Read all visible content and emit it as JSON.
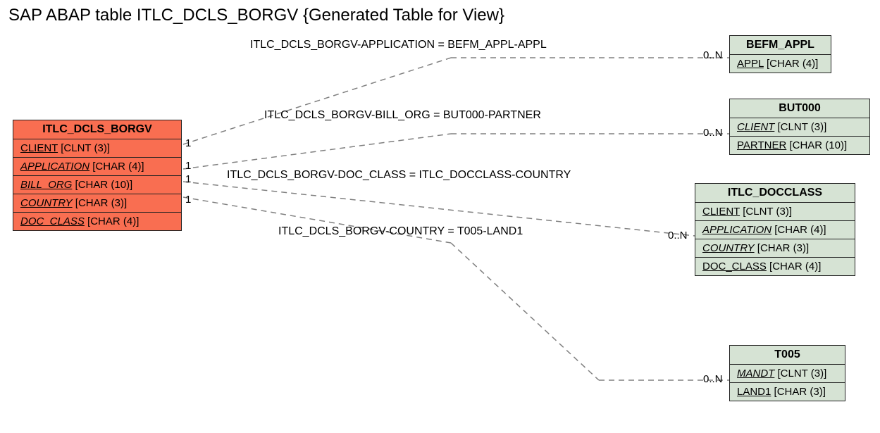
{
  "title": "SAP ABAP table ITLC_DCLS_BORGV {Generated Table for View}",
  "entities": {
    "main": {
      "name": "ITLC_DCLS_BORGV",
      "fields": [
        {
          "name": "CLIENT",
          "type": "[CLNT (3)]",
          "underline": true,
          "italic": false
        },
        {
          "name": "APPLICATION",
          "type": "[CHAR (4)]",
          "underline": true,
          "italic": true
        },
        {
          "name": "BILL_ORG",
          "type": "[CHAR (10)]",
          "underline": true,
          "italic": true
        },
        {
          "name": "COUNTRY",
          "type": "[CHAR (3)]",
          "underline": true,
          "italic": true
        },
        {
          "name": "DOC_CLASS",
          "type": "[CHAR (4)]",
          "underline": true,
          "italic": true
        }
      ]
    },
    "befm_appl": {
      "name": "BEFM_APPL",
      "fields": [
        {
          "name": "APPL",
          "type": "[CHAR (4)]",
          "underline": true,
          "italic": false
        }
      ]
    },
    "but000": {
      "name": "BUT000",
      "fields": [
        {
          "name": "CLIENT",
          "type": "[CLNT (3)]",
          "underline": true,
          "italic": true
        },
        {
          "name": "PARTNER",
          "type": "[CHAR (10)]",
          "underline": true,
          "italic": false
        }
      ]
    },
    "itlc_docclass": {
      "name": "ITLC_DOCCLASS",
      "fields": [
        {
          "name": "CLIENT",
          "type": "[CLNT (3)]",
          "underline": true,
          "italic": false
        },
        {
          "name": "APPLICATION",
          "type": "[CHAR (4)]",
          "underline": true,
          "italic": true
        },
        {
          "name": "COUNTRY",
          "type": "[CHAR (3)]",
          "underline": true,
          "italic": true
        },
        {
          "name": "DOC_CLASS",
          "type": "[CHAR (4)]",
          "underline": true,
          "italic": false
        }
      ]
    },
    "t005": {
      "name": "T005",
      "fields": [
        {
          "name": "MANDT",
          "type": "[CLNT (3)]",
          "underline": true,
          "italic": true
        },
        {
          "name": "LAND1",
          "type": "[CHAR (3)]",
          "underline": true,
          "italic": false
        }
      ]
    }
  },
  "relations": {
    "r1": {
      "label": "ITLC_DCLS_BORGV-APPLICATION = BEFM_APPL-APPL",
      "left_card": "1",
      "right_card": "0..N"
    },
    "r2": {
      "label": "ITLC_DCLS_BORGV-BILL_ORG = BUT000-PARTNER",
      "left_card": "1",
      "right_card": "0..N"
    },
    "r3": {
      "label": "ITLC_DCLS_BORGV-DOC_CLASS = ITLC_DOCCLASS-COUNTRY",
      "left_card": "1",
      "right_card": ""
    },
    "r4": {
      "label": "ITLC_DCLS_BORGV-COUNTRY = T005-LAND1",
      "left_card": "1",
      "right_card": "0..N"
    }
  },
  "extra_cards": {
    "docclass_card": "0..N"
  }
}
